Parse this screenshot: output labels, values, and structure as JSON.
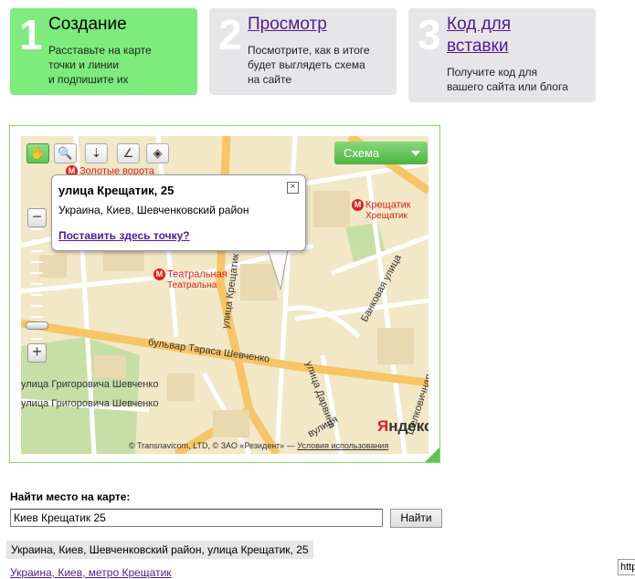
{
  "steps": [
    {
      "num": "1",
      "title": "Создание",
      "desc": "Расставьте на карте\nточки и линии\nи подпишите их"
    },
    {
      "num": "2",
      "title": "Просмотр",
      "desc": "Посмотрите, как в итоге\nбудет выглядеть схема\nна сайте"
    },
    {
      "num": "3",
      "title": "Код для\nвставки",
      "desc": "Получите код для\nвашего сайта или блога"
    }
  ],
  "map": {
    "layer_button": "Схема",
    "tools": [
      "hand-icon",
      "magnifier-zoom-icon",
      "placemark-icon",
      "polyline-icon",
      "polygon-icon"
    ],
    "zoom_in": "+",
    "zoom_out": "−",
    "zoom_level_fraction": 0.78,
    "balloon": {
      "title": "улица Крещатик, 25",
      "address": "Украина, Киев, Шевченковский район",
      "link": "Поставить здесь точку?"
    },
    "metro": [
      {
        "name": "Золотые ворота",
        "sub": ""
      },
      {
        "name": "Крещатик",
        "sub": "Хрещатик"
      },
      {
        "name": "Театральная",
        "sub": "Театральна"
      }
    ],
    "streets": {
      "shevchenko_blvd": "бульвар Тараса Шевченко",
      "shevchenko_name1": "улица Григоровича Шевченко",
      "shevchenko_name2": "улица Григоровича Шевченко",
      "bankovaya": "Банковая улица",
      "shelkovichnaya": "Шелковичная улица",
      "darvina": "улица Дарвина",
      "kreshchatik": "улица Крещатик",
      "prorizna": "вулиця",
      "ulitsa": "улица"
    },
    "logo": {
      "ya": "Я",
      "rest": "ндекс"
    },
    "copyright": "© Transnavicom, LTD, © ЗАО «Резидент» — ",
    "terms": "Условия использования",
    "colors": {
      "accent": "#5cc556",
      "metro": "#e0201b",
      "frame": "#8ccf6f"
    }
  },
  "search": {
    "label": "Найти место на карте:",
    "value": "Киев Крещатик 25",
    "button": "Найти",
    "results": [
      "Украина, Киев, Шевченковский район, улица Крещатик, 25",
      "Украина, Киев, метро Крещатик"
    ]
  },
  "status_tip": "http"
}
